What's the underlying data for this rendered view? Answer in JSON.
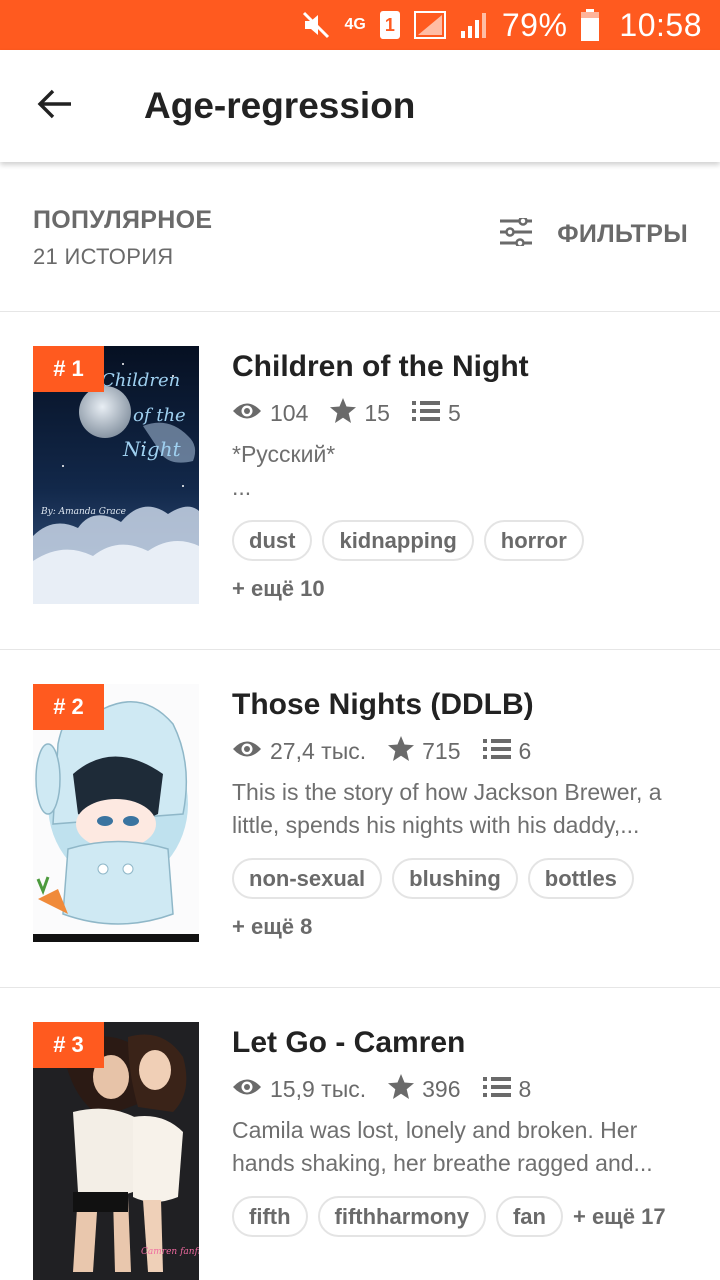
{
  "status_bar": {
    "network": "4G",
    "sim": "1",
    "battery": "79%",
    "time": "10:58",
    "icons": [
      "mute-icon",
      "network-4g-icon",
      "sim-1-icon",
      "no-signal-icon",
      "signal-icon",
      "battery-icon"
    ],
    "bg_color": "#ff5a1f"
  },
  "app_bar": {
    "title": "Age-regression",
    "back_icon": "arrow-left-icon"
  },
  "list_header": {
    "sort": "ПОПУЛЯРНОЕ",
    "count": "21 ИСТОРИЯ",
    "filters_label": "ФИЛЬТРЫ",
    "filters_icon": "sliders-icon"
  },
  "accent_color": "#ff5a1f",
  "stories": [
    {
      "rank": "# 1",
      "title": "Children of the Night",
      "reads": "104",
      "votes": "15",
      "parts": "5",
      "description_lines": [
        "*Русский*",
        "..."
      ],
      "tags": [
        "dust",
        "kidnapping",
        "horror"
      ],
      "more": "+ ещё 10",
      "cover_text_title": "Children of the Night",
      "cover_text_author": "By: Amanda Grace"
    },
    {
      "rank": "# 2",
      "title": "Those Nights (DDLB)",
      "reads": "27,4 тыс.",
      "votes": "715",
      "parts": "6",
      "description_lines": [
        "This is the story of how Jackson Brewer, a",
        "little, spends his nights with his daddy,..."
      ],
      "tags": [
        "non-sexual",
        "blushing",
        "bottles"
      ],
      "more": "+ ещё 8"
    },
    {
      "rank": "# 3",
      "title": "Let Go - Camren",
      "reads": "15,9 тыс.",
      "votes": "396",
      "parts": "8",
      "description_lines": [
        "Camila was lost, lonely and broken. Her",
        "hands shaking, her breathe ragged and..."
      ],
      "tags": [
        "fifth",
        "fifthharmony",
        "fan"
      ],
      "more": "+ ещё 17",
      "cover_text_author": "Camren fanfic"
    }
  ]
}
